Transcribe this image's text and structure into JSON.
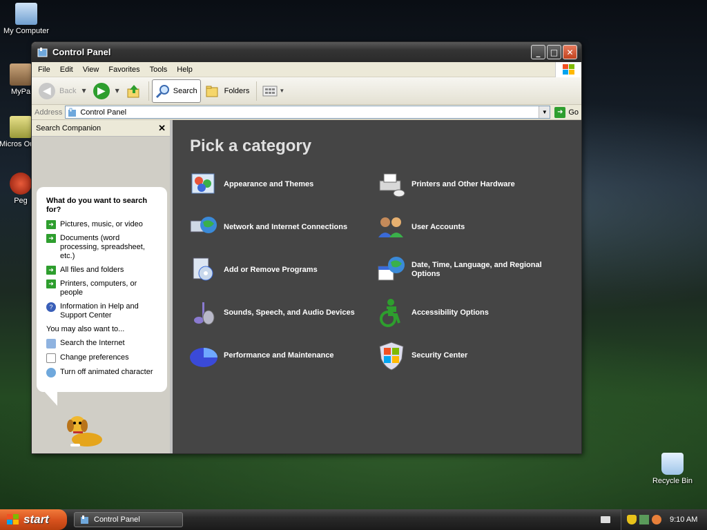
{
  "desktop": {
    "icons": [
      {
        "label": "My Computer"
      },
      {
        "label": "MyPa"
      },
      {
        "label": "Micros Outlo"
      },
      {
        "label": "Peg"
      },
      {
        "label": "Recycle Bin"
      }
    ]
  },
  "window": {
    "title": "Control Panel",
    "controls": {
      "minimize": "_",
      "maximize": "□",
      "close": "✕"
    },
    "menu": [
      "File",
      "Edit",
      "View",
      "Favorites",
      "Tools",
      "Help"
    ],
    "toolbar": {
      "back": "Back",
      "search": "Search",
      "folders": "Folders"
    },
    "address": {
      "label": "Address",
      "value": "Control Panel",
      "go": "Go"
    }
  },
  "search_companion": {
    "header": "Search Companion",
    "close": "✕",
    "question": "What do you want to search for?",
    "options": [
      "Pictures, music, or video",
      "Documents (word processing, spreadsheet, etc.)",
      "All files and folders",
      "Printers, computers, or people",
      "Information in Help and Support Center"
    ],
    "also_label": "You may also want to...",
    "also_options": [
      "Search the Internet",
      "Change preferences",
      "Turn off animated character"
    ]
  },
  "main": {
    "heading": "Pick a category",
    "categories": [
      {
        "label": "Appearance and Themes",
        "icon": "appearance-themes-icon"
      },
      {
        "label": "Printers and Other Hardware",
        "icon": "printers-hardware-icon"
      },
      {
        "label": "Network and Internet Connections",
        "icon": "network-internet-icon"
      },
      {
        "label": "User Accounts",
        "icon": "user-accounts-icon"
      },
      {
        "label": "Add or Remove Programs",
        "icon": "add-remove-programs-icon"
      },
      {
        "label": "Date, Time, Language, and Regional Options",
        "icon": "date-time-language-icon"
      },
      {
        "label": "Sounds, Speech, and Audio Devices",
        "icon": "sounds-speech-audio-icon"
      },
      {
        "label": "Accessibility Options",
        "icon": "accessibility-icon"
      },
      {
        "label": "Performance and Maintenance",
        "icon": "performance-maintenance-icon"
      },
      {
        "label": "Security Center",
        "icon": "security-center-icon"
      }
    ]
  },
  "taskbar": {
    "start": "start",
    "tasks": [
      {
        "label": "Control Panel"
      }
    ],
    "clock": "9:10 AM"
  },
  "colors": {
    "content_bg": "#454545",
    "start_orange": "#d9531f",
    "arrow_green": "#2e9e2e"
  }
}
